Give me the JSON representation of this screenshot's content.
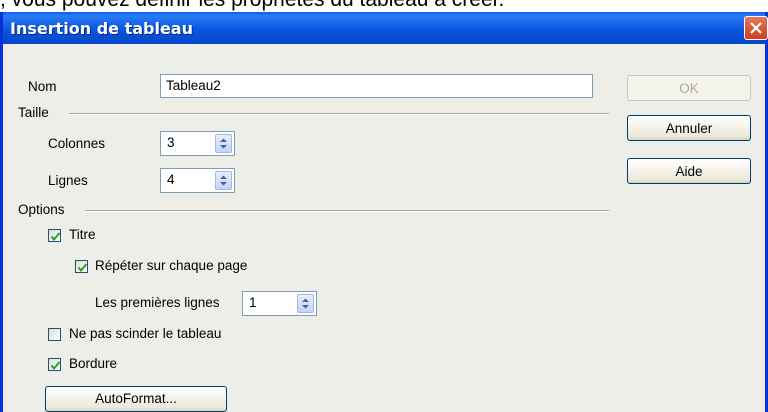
{
  "caption": ", vous pouvez définir les propriétés du tableau à créer.",
  "dialog": {
    "title": "Insertion de tableau",
    "name_label": "Nom",
    "name_value": "Tableau2",
    "size_group": "Taille",
    "columns_label": "Colonnes",
    "columns_value": "3",
    "rows_label": "Lignes",
    "rows_value": "4",
    "options_group": "Options",
    "title_check": {
      "label": "Titre",
      "checked": true
    },
    "repeat_check": {
      "label": "Répéter sur chaque page",
      "checked": true
    },
    "first_rows_label": "Les premières lignes",
    "first_rows_value": "1",
    "no_split_check": {
      "label": "Ne pas scinder le tableau",
      "checked": false
    },
    "border_check": {
      "label": "Bordure",
      "checked": true
    },
    "autoformat_label": "AutoFormat...",
    "ok_label": "OK",
    "cancel_label": "Annuler",
    "help_label": "Aide"
  },
  "colors": {
    "titlebar": "#0857e0",
    "frame": "#0831d9",
    "check": "#21a121"
  }
}
